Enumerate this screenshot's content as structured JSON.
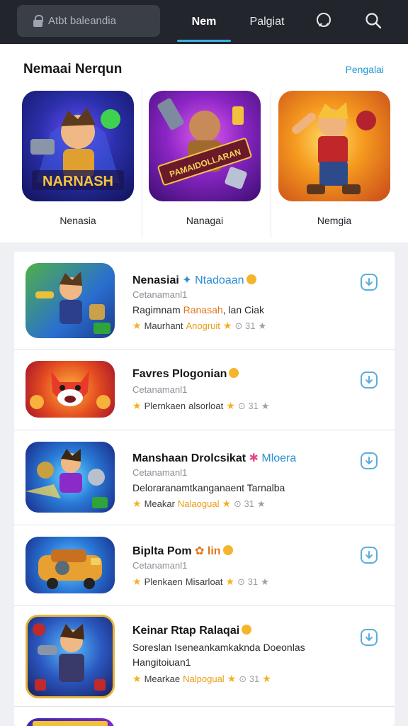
{
  "header": {
    "search_placeholder": "Atbt baleandia",
    "tab_active": "Nem",
    "tab_second": "Palgiat",
    "icons": [
      "chat-bubble-icon",
      "search-icon"
    ]
  },
  "featured": {
    "title": "Nemaai Nerqun",
    "see_all": "Pengalai",
    "items": [
      {
        "label": "Nenasia",
        "art_text": "NARNASH"
      },
      {
        "label": "Nanagai",
        "art_text": "PAMAIDOLLARAN"
      },
      {
        "label": "Nemgia",
        "art_text": ""
      }
    ]
  },
  "list": [
    {
      "title": "Nenasiai",
      "title_accent": "Ntadoaan",
      "subtitle": "Cetanamanl1",
      "desc_prefix": "Ragimnam",
      "desc_highlight": "Ranasah",
      "desc_suffix": ", lan Ciak",
      "meta_label": "Maurhant",
      "meta_highlight": "Anogruit",
      "meta_count": "31"
    },
    {
      "title": "Favres Plogonian",
      "title_accent": "",
      "subtitle": "Cetanamanl1",
      "desc_prefix": "",
      "desc_highlight": "",
      "desc_suffix": "",
      "meta_label": "Plernkaen",
      "meta_highlight": "",
      "meta_plain": "alsorloat",
      "meta_count": "31"
    },
    {
      "title": "Manshaan Drolcsikat",
      "title_accent": "Mloera",
      "subtitle": "Cetanamanl1",
      "desc_prefix": "Deloraranamtkanganaent Tarnalba",
      "desc_highlight": "",
      "desc_suffix": "",
      "meta_label": "Meakar",
      "meta_highlight": "Nalaogual",
      "meta_count": "31"
    },
    {
      "title": "Biplta Pom",
      "title_accent": "",
      "title_orange": "lin",
      "subtitle": "Cetanamanl1",
      "desc_prefix": "",
      "desc_highlight": "",
      "desc_suffix": "",
      "meta_label": "Plenkaen",
      "meta_highlight": "",
      "meta_plain": "Misarloat",
      "meta_count": "31"
    },
    {
      "title": "Keinar Rtap Ralaqai",
      "title_accent": "",
      "subtitle": "",
      "desc_prefix": "Soreslan Iseneankamkaknda Doeonlas",
      "desc_line2": "Hangitoiuan1",
      "desc_highlight": "",
      "desc_suffix": "",
      "meta_label": "Mearkae",
      "meta_highlight": "Nalpogual",
      "meta_count": "31"
    }
  ],
  "colors": {
    "accent": "#3fb0e8",
    "topbar": "#22252c",
    "highlight": "#e4761c",
    "star": "#f2b21a"
  }
}
